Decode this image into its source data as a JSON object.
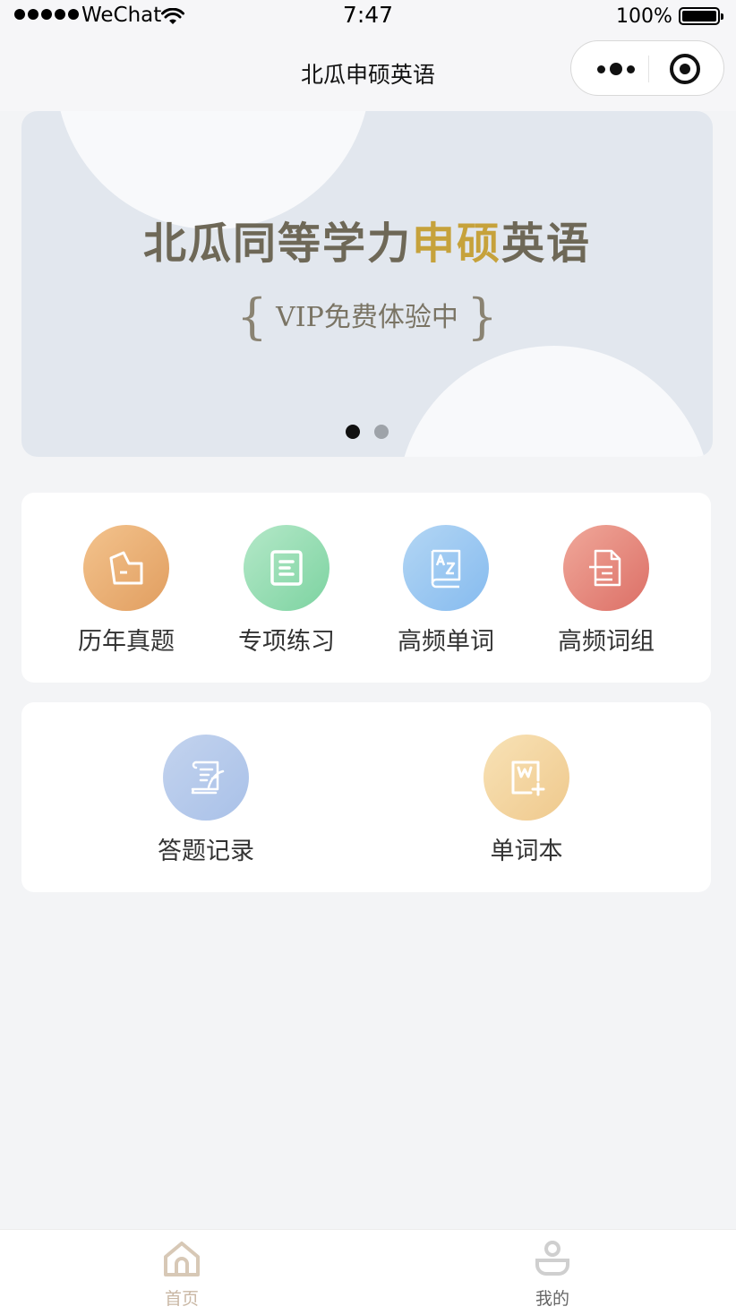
{
  "status_bar": {
    "carrier": "WeChat",
    "time": "7:47",
    "battery": "100%"
  },
  "nav": {
    "title": "北瓜申硕英语"
  },
  "banner": {
    "headline_prefix": "北瓜同等学力",
    "headline_highlight": "申硕",
    "headline_suffix": "英语",
    "subtitle": "VIP免费体验中",
    "brace_left": "{",
    "brace_right": "}",
    "slides": 2,
    "active_slide": 1,
    "highlight_color": "#c6a23b"
  },
  "menu_main": {
    "items": [
      {
        "label": "历年真题",
        "icon": "folder-file-icon",
        "color": "#e9a96d"
      },
      {
        "label": "专项练习",
        "icon": "document-list-icon",
        "color": "#8fd9ad"
      },
      {
        "label": "高频单词",
        "icon": "az-book-icon",
        "color": "#98c6f1"
      },
      {
        "label": "高频词组",
        "icon": "file-lines-icon",
        "color": "#e3837a"
      }
    ]
  },
  "menu_secondary": {
    "items": [
      {
        "label": "答题记录",
        "icon": "scroll-quill-icon",
        "color": "#b4c9ec"
      },
      {
        "label": "单词本",
        "icon": "wordbook-add-icon",
        "color": "#f3d29e"
      }
    ]
  },
  "tab_bar": {
    "items": [
      {
        "label": "首页",
        "icon": "home-icon",
        "active": true
      },
      {
        "label": "我的",
        "icon": "user-icon",
        "active": false
      }
    ]
  }
}
